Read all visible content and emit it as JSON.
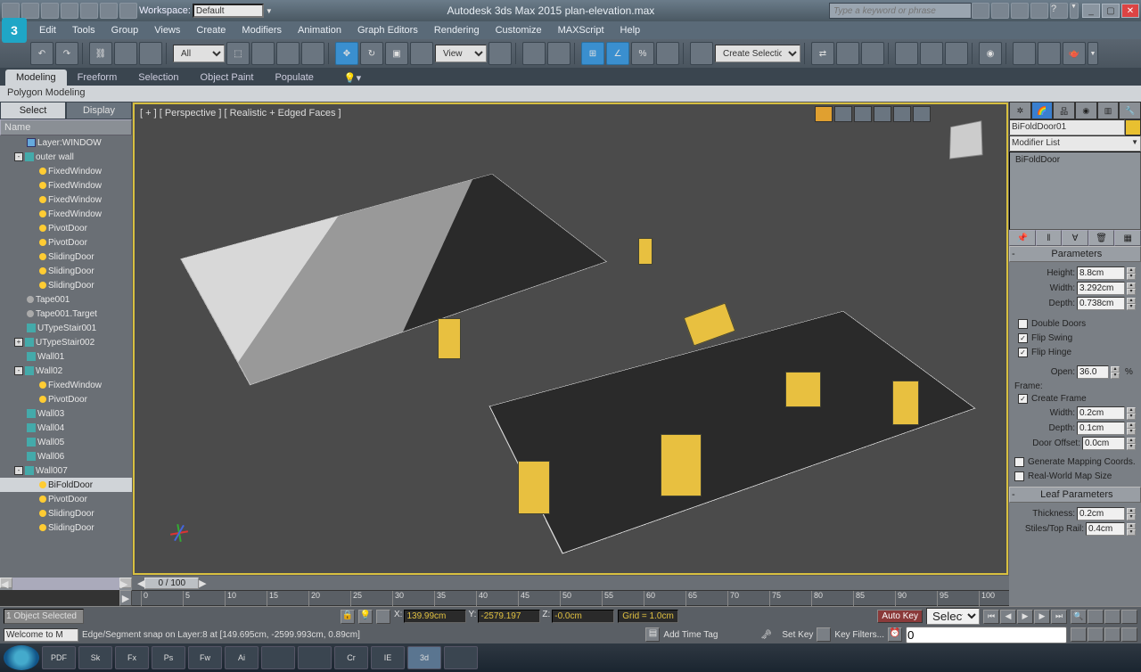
{
  "app": {
    "title": "Autodesk 3ds Max  2015     plan-elevation.max",
    "workspace_label": "Workspace:",
    "workspace_value": "Default",
    "search_placeholder": "Type a keyword or phrase"
  },
  "menu": [
    "Edit",
    "Tools",
    "Group",
    "Views",
    "Create",
    "Modifiers",
    "Animation",
    "Graph Editors",
    "Rendering",
    "Customize",
    "MAXScript",
    "Help"
  ],
  "maintb": {
    "filter_combo": "All",
    "view_combo": "View"
  },
  "named_sel": "Create Selection Set",
  "ribbon_tabs": [
    "Modeling",
    "Freeform",
    "Selection",
    "Object Paint",
    "Populate"
  ],
  "ribbon_active": "Modeling",
  "ribbon_panel": "Polygon Modeling",
  "scene": {
    "tabs": [
      "Select",
      "Display"
    ],
    "active_tab": "Select",
    "header": "Name",
    "tree": [
      {
        "ind": 30,
        "toggle": "",
        "layer": true,
        "label": "Layer:WINDOW"
      },
      {
        "ind": 16,
        "toggle": "-",
        "cube": true,
        "label": "outer wall"
      },
      {
        "ind": 44,
        "dot": true,
        "label": "FixedWindow"
      },
      {
        "ind": 44,
        "dot": true,
        "label": "FixedWindow"
      },
      {
        "ind": 44,
        "dot": true,
        "label": "FixedWindow"
      },
      {
        "ind": 44,
        "dot": true,
        "label": "FixedWindow"
      },
      {
        "ind": 44,
        "dot": true,
        "label": "PivotDoor"
      },
      {
        "ind": 44,
        "dot": true,
        "label": "PivotDoor"
      },
      {
        "ind": 44,
        "dot": true,
        "label": "SlidingDoor"
      },
      {
        "ind": 44,
        "dot": true,
        "label": "SlidingDoor"
      },
      {
        "ind": 44,
        "dot": true,
        "label": "SlidingDoor"
      },
      {
        "ind": 30,
        "dot": "grey",
        "label": "Tape001"
      },
      {
        "ind": 30,
        "dot": "grey",
        "label": "Tape001.Target"
      },
      {
        "ind": 30,
        "cube": true,
        "label": "UTypeStair001"
      },
      {
        "ind": 16,
        "toggle": "+",
        "cube": true,
        "label": "UTypeStair002"
      },
      {
        "ind": 30,
        "cube": true,
        "label": "Wall01"
      },
      {
        "ind": 16,
        "toggle": "-",
        "cube": true,
        "label": "Wall02"
      },
      {
        "ind": 44,
        "dot": true,
        "label": "FixedWindow"
      },
      {
        "ind": 44,
        "dot": true,
        "label": "PivotDoor"
      },
      {
        "ind": 30,
        "cube": true,
        "label": "Wall03"
      },
      {
        "ind": 30,
        "cube": true,
        "label": "Wall04"
      },
      {
        "ind": 30,
        "cube": true,
        "label": "Wall05"
      },
      {
        "ind": 30,
        "cube": true,
        "label": "Wall06"
      },
      {
        "ind": 16,
        "toggle": "-",
        "cube": true,
        "label": "Wall007"
      },
      {
        "ind": 44,
        "dot": true,
        "label": "BiFoldDoor",
        "sel": true
      },
      {
        "ind": 44,
        "dot": true,
        "label": "PivotDoor"
      },
      {
        "ind": 44,
        "dot": true,
        "label": "SlidingDoor"
      },
      {
        "ind": 44,
        "dot": true,
        "label": "SlidingDoor"
      }
    ]
  },
  "viewport": {
    "label": "[ + ] [ Perspective ] [ Realistic + Edged Faces ]"
  },
  "time": {
    "slider": "0 / 100",
    "ticks": [
      "0",
      "5",
      "10",
      "15",
      "20",
      "25",
      "30",
      "35",
      "40",
      "45",
      "50",
      "55",
      "60",
      "65",
      "70",
      "75",
      "80",
      "85",
      "90",
      "95",
      "100"
    ]
  },
  "cmd": {
    "object_name": "BiFoldDoor01",
    "modifier_list": "Modifier List",
    "stack_item": "BiFoldDoor",
    "rollout_params": "Parameters",
    "height_label": "Height:",
    "height": "8.8cm",
    "width_label": "Width:",
    "width": "3.292cm",
    "depth_label": "Depth:",
    "depth": "0.738cm",
    "double_doors": "Double Doors",
    "flip_swing": "Flip Swing",
    "flip_hinge": "Flip Hinge",
    "open_label": "Open:",
    "open": "36.0",
    "open_unit": "%",
    "frame_label": "Frame:",
    "create_frame": "Create Frame",
    "fwidth_label": "Width:",
    "fwidth": "0.2cm",
    "fdepth_label": "Depth:",
    "fdepth": "0.1cm",
    "door_offset_label": "Door Offset:",
    "door_offset": "0.0cm",
    "gen_map": "Generate Mapping Coords.",
    "real_world": "Real-World Map Size",
    "rollout_leaf": "Leaf Parameters",
    "thick_label": "Thickness:",
    "thick": "0.2cm",
    "stiles_label": "Stiles/Top Rail:",
    "stiles": "0.4cm"
  },
  "status": {
    "selected": "1 Object Selected",
    "x_label": "X:",
    "x": "139.99cm",
    "y_label": "Y:",
    "y": "-2579.197",
    "z_label": "Z:",
    "z": "-0.0cm",
    "grid": "Grid = 1.0cm",
    "add_time_tag": "Add Time Tag",
    "auto_key": "Auto Key",
    "selected_combo": "Selected",
    "set_key": "Set Key",
    "key_filters": "Key Filters...",
    "frame": "0",
    "welcome": "Welcome to M",
    "snap": "Edge/Segment snap on Layer:8 at [149.695cm, -2599.993cm, 0.89cm]"
  },
  "taskbar": [
    "PDF",
    "Sk",
    "Fx",
    "Ps",
    "Fw",
    "Ai",
    "",
    "",
    "Cr",
    "IE",
    "3d",
    ""
  ]
}
